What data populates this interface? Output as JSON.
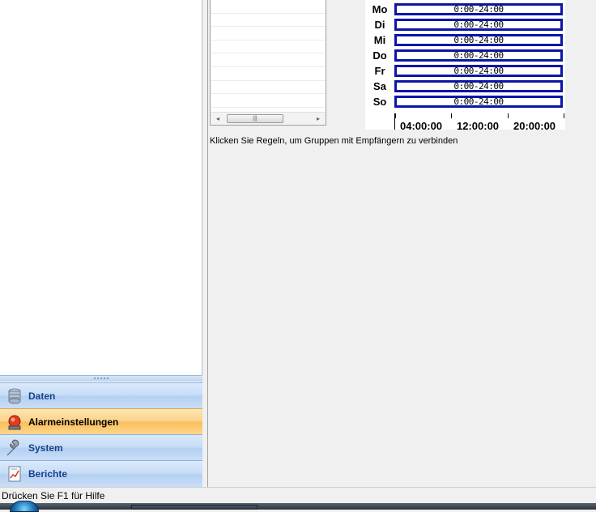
{
  "nav": {
    "items": [
      {
        "label": "Daten",
        "icon": "database-icon",
        "active": false
      },
      {
        "label": "Alarmeinstellungen",
        "icon": "alarm-siren-icon",
        "active": true
      },
      {
        "label": "System",
        "icon": "wrench-icon",
        "active": false
      },
      {
        "label": "Berichte",
        "icon": "report-icon",
        "active": false
      }
    ]
  },
  "schedule": {
    "days": [
      {
        "day": "Mo",
        "range": "0:00-24:00"
      },
      {
        "day": "Di",
        "range": "0:00-24:00"
      },
      {
        "day": "Mi",
        "range": "0:00-24:00"
      },
      {
        "day": "Do",
        "range": "0:00-24:00"
      },
      {
        "day": "Fr",
        "range": "0:00-24:00"
      },
      {
        "day": "Sa",
        "range": "0:00-24:00"
      },
      {
        "day": "So",
        "range": "0:00-24:00"
      }
    ],
    "axis_labels": [
      "04:00:00",
      "12:00:00",
      "20:00:00"
    ],
    "bar_color": "#0b16a6"
  },
  "hint_text": "Klicken Sie Regeln, um Gruppen mit Empfängern zu verbinden",
  "status_bar": {
    "text": "Drücken Sie F1 für Hilfe"
  },
  "scrollbar": {
    "left_arrow": "◂",
    "right_arrow": "▸",
    "thumb_grip": "|||"
  }
}
